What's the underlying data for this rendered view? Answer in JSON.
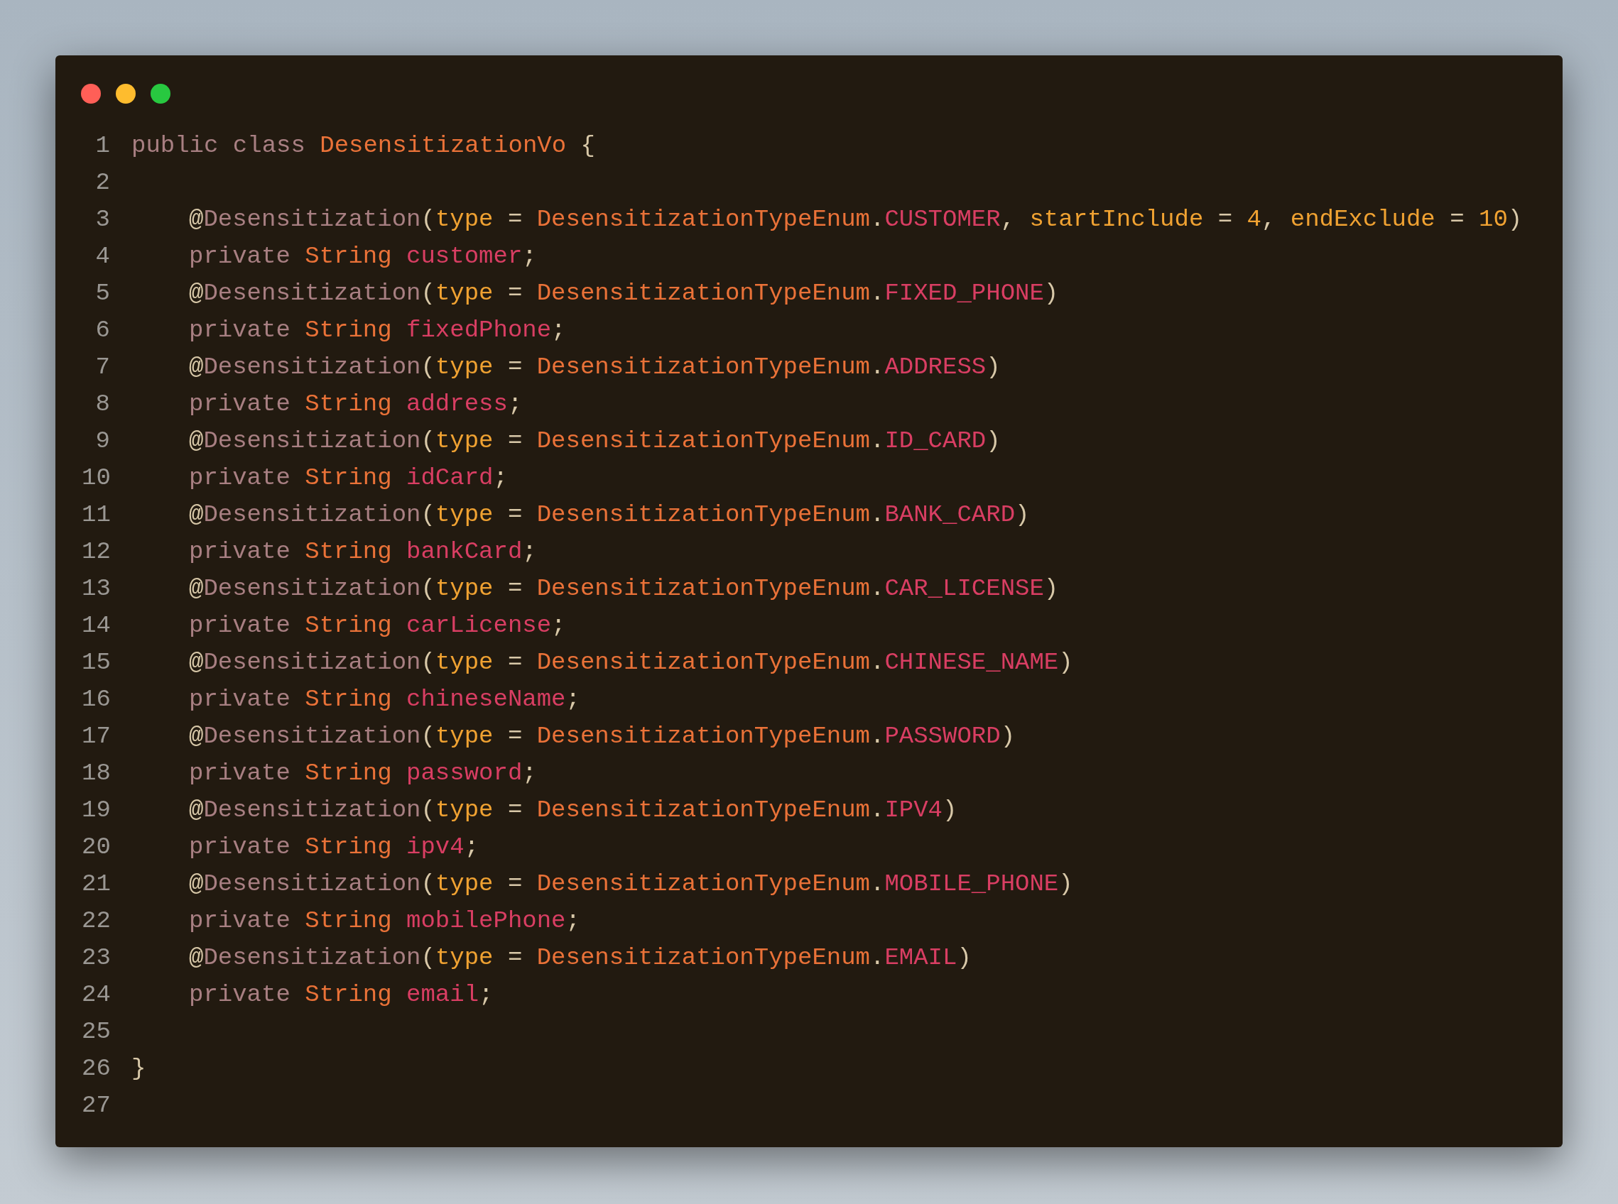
{
  "window": {
    "controls": [
      {
        "kind": "close"
      },
      {
        "kind": "minimize"
      },
      {
        "kind": "maximize"
      }
    ]
  },
  "lines": [
    {
      "number": "1",
      "indented": false,
      "tokens": [
        {
          "kind": "keyword",
          "text": "public class "
        },
        {
          "kind": "type",
          "text": "DesensitizationVo "
        },
        {
          "kind": "punct",
          "text": "{"
        }
      ]
    },
    {
      "number": "2"
    },
    {
      "number": "3",
      "indented": true,
      "tokens": [
        {
          "kind": "punct",
          "text": "@"
        },
        {
          "kind": "keyword",
          "text": "Desensitization"
        },
        {
          "kind": "punct",
          "text": "("
        },
        {
          "kind": "param",
          "text": "type "
        },
        {
          "kind": "punct",
          "text": "= "
        },
        {
          "kind": "type",
          "text": "DesensitizationTypeEnum"
        },
        {
          "kind": "punct",
          "text": "."
        },
        {
          "kind": "field",
          "text": "CUSTOMER"
        },
        {
          "kind": "punct",
          "text": ", "
        },
        {
          "kind": "param",
          "text": "startInclude "
        },
        {
          "kind": "punct",
          "text": "= "
        },
        {
          "kind": "param",
          "text": "4"
        },
        {
          "kind": "punct",
          "text": ", "
        },
        {
          "kind": "param",
          "text": "endExclude "
        },
        {
          "kind": "punct",
          "text": "= "
        },
        {
          "kind": "param",
          "text": "10"
        },
        {
          "kind": "punct",
          "text": ")"
        }
      ]
    },
    {
      "number": "4",
      "indented": true,
      "tokens": [
        {
          "kind": "keyword",
          "text": "private "
        },
        {
          "kind": "type",
          "text": "String "
        },
        {
          "kind": "field",
          "text": "customer"
        },
        {
          "kind": "punct",
          "text": ";"
        }
      ]
    },
    {
      "number": "5",
      "indented": true,
      "tokens": [
        {
          "kind": "punct",
          "text": "@"
        },
        {
          "kind": "keyword",
          "text": "Desensitization"
        },
        {
          "kind": "punct",
          "text": "("
        },
        {
          "kind": "param",
          "text": "type "
        },
        {
          "kind": "punct",
          "text": "= "
        },
        {
          "kind": "type",
          "text": "DesensitizationTypeEnum"
        },
        {
          "kind": "punct",
          "text": "."
        },
        {
          "kind": "field",
          "text": "FIXED_PHONE"
        },
        {
          "kind": "punct",
          "text": ")"
        }
      ]
    },
    {
      "number": "6",
      "indented": true,
      "tokens": [
        {
          "kind": "keyword",
          "text": "private "
        },
        {
          "kind": "type",
          "text": "String "
        },
        {
          "kind": "field",
          "text": "fixedPhone"
        },
        {
          "kind": "punct",
          "text": ";"
        }
      ]
    },
    {
      "number": "7",
      "indented": true,
      "tokens": [
        {
          "kind": "punct",
          "text": "@"
        },
        {
          "kind": "keyword",
          "text": "Desensitization"
        },
        {
          "kind": "punct",
          "text": "("
        },
        {
          "kind": "param",
          "text": "type "
        },
        {
          "kind": "punct",
          "text": "= "
        },
        {
          "kind": "type",
          "text": "DesensitizationTypeEnum"
        },
        {
          "kind": "punct",
          "text": "."
        },
        {
          "kind": "field",
          "text": "ADDRESS"
        },
        {
          "kind": "punct",
          "text": ")"
        }
      ]
    },
    {
      "number": "8",
      "indented": true,
      "tokens": [
        {
          "kind": "keyword",
          "text": "private "
        },
        {
          "kind": "type",
          "text": "String "
        },
        {
          "kind": "field",
          "text": "address"
        },
        {
          "kind": "punct",
          "text": ";"
        }
      ]
    },
    {
      "number": "9",
      "indented": true,
      "tokens": [
        {
          "kind": "punct",
          "text": "@"
        },
        {
          "kind": "keyword",
          "text": "Desensitization"
        },
        {
          "kind": "punct",
          "text": "("
        },
        {
          "kind": "param",
          "text": "type "
        },
        {
          "kind": "punct",
          "text": "= "
        },
        {
          "kind": "type",
          "text": "DesensitizationTypeEnum"
        },
        {
          "kind": "punct",
          "text": "."
        },
        {
          "kind": "field",
          "text": "ID_CARD"
        },
        {
          "kind": "punct",
          "text": ")"
        }
      ]
    },
    {
      "number": "10",
      "indented": true,
      "tokens": [
        {
          "kind": "keyword",
          "text": "private "
        },
        {
          "kind": "type",
          "text": "String "
        },
        {
          "kind": "field",
          "text": "idCard"
        },
        {
          "kind": "punct",
          "text": ";"
        }
      ]
    },
    {
      "number": "11",
      "indented": true,
      "tokens": [
        {
          "kind": "punct",
          "text": "@"
        },
        {
          "kind": "keyword",
          "text": "Desensitization"
        },
        {
          "kind": "punct",
          "text": "("
        },
        {
          "kind": "param",
          "text": "type "
        },
        {
          "kind": "punct",
          "text": "= "
        },
        {
          "kind": "type",
          "text": "DesensitizationTypeEnum"
        },
        {
          "kind": "punct",
          "text": "."
        },
        {
          "kind": "field",
          "text": "BANK_CARD"
        },
        {
          "kind": "punct",
          "text": ")"
        }
      ]
    },
    {
      "number": "12",
      "indented": true,
      "tokens": [
        {
          "kind": "keyword",
          "text": "private "
        },
        {
          "kind": "type",
          "text": "String "
        },
        {
          "kind": "field",
          "text": "bankCard"
        },
        {
          "kind": "punct",
          "text": ";"
        }
      ]
    },
    {
      "number": "13",
      "indented": true,
      "tokens": [
        {
          "kind": "punct",
          "text": "@"
        },
        {
          "kind": "keyword",
          "text": "Desensitization"
        },
        {
          "kind": "punct",
          "text": "("
        },
        {
          "kind": "param",
          "text": "type "
        },
        {
          "kind": "punct",
          "text": "= "
        },
        {
          "kind": "type",
          "text": "DesensitizationTypeEnum"
        },
        {
          "kind": "punct",
          "text": "."
        },
        {
          "kind": "field",
          "text": "CAR_LICENSE"
        },
        {
          "kind": "punct",
          "text": ")"
        }
      ]
    },
    {
      "number": "14",
      "indented": true,
      "tokens": [
        {
          "kind": "keyword",
          "text": "private "
        },
        {
          "kind": "type",
          "text": "String "
        },
        {
          "kind": "field",
          "text": "carLicense"
        },
        {
          "kind": "punct",
          "text": ";"
        }
      ]
    },
    {
      "number": "15",
      "indented": true,
      "tokens": [
        {
          "kind": "punct",
          "text": "@"
        },
        {
          "kind": "keyword",
          "text": "Desensitization"
        },
        {
          "kind": "punct",
          "text": "("
        },
        {
          "kind": "param",
          "text": "type "
        },
        {
          "kind": "punct",
          "text": "= "
        },
        {
          "kind": "type",
          "text": "DesensitizationTypeEnum"
        },
        {
          "kind": "punct",
          "text": "."
        },
        {
          "kind": "field",
          "text": "CHINESE_NAME"
        },
        {
          "kind": "punct",
          "text": ")"
        }
      ]
    },
    {
      "number": "16",
      "indented": true,
      "tokens": [
        {
          "kind": "keyword",
          "text": "private "
        },
        {
          "kind": "type",
          "text": "String "
        },
        {
          "kind": "field",
          "text": "chineseName"
        },
        {
          "kind": "punct",
          "text": ";"
        }
      ]
    },
    {
      "number": "17",
      "indented": true,
      "tokens": [
        {
          "kind": "punct",
          "text": "@"
        },
        {
          "kind": "keyword",
          "text": "Desensitization"
        },
        {
          "kind": "punct",
          "text": "("
        },
        {
          "kind": "param",
          "text": "type "
        },
        {
          "kind": "punct",
          "text": "= "
        },
        {
          "kind": "type",
          "text": "DesensitizationTypeEnum"
        },
        {
          "kind": "punct",
          "text": "."
        },
        {
          "kind": "field",
          "text": "PASSWORD"
        },
        {
          "kind": "punct",
          "text": ")"
        }
      ]
    },
    {
      "number": "18",
      "indented": true,
      "tokens": [
        {
          "kind": "keyword",
          "text": "private "
        },
        {
          "kind": "type",
          "text": "String "
        },
        {
          "kind": "field",
          "text": "password"
        },
        {
          "kind": "punct",
          "text": ";"
        }
      ]
    },
    {
      "number": "19",
      "indented": true,
      "tokens": [
        {
          "kind": "punct",
          "text": "@"
        },
        {
          "kind": "keyword",
          "text": "Desensitization"
        },
        {
          "kind": "punct",
          "text": "("
        },
        {
          "kind": "param",
          "text": "type "
        },
        {
          "kind": "punct",
          "text": "= "
        },
        {
          "kind": "type",
          "text": "DesensitizationTypeEnum"
        },
        {
          "kind": "punct",
          "text": "."
        },
        {
          "kind": "field",
          "text": "IPV4"
        },
        {
          "kind": "punct",
          "text": ")"
        }
      ]
    },
    {
      "number": "20",
      "indented": true,
      "tokens": [
        {
          "kind": "keyword",
          "text": "private "
        },
        {
          "kind": "type",
          "text": "String "
        },
        {
          "kind": "field",
          "text": "ipv4"
        },
        {
          "kind": "punct",
          "text": ";"
        }
      ]
    },
    {
      "number": "21",
      "indented": true,
      "tokens": [
        {
          "kind": "punct",
          "text": "@"
        },
        {
          "kind": "keyword",
          "text": "Desensitization"
        },
        {
          "kind": "punct",
          "text": "("
        },
        {
          "kind": "param",
          "text": "type "
        },
        {
          "kind": "punct",
          "text": "= "
        },
        {
          "kind": "type",
          "text": "DesensitizationTypeEnum"
        },
        {
          "kind": "punct",
          "text": "."
        },
        {
          "kind": "field",
          "text": "MOBILE_PHONE"
        },
        {
          "kind": "punct",
          "text": ")"
        }
      ]
    },
    {
      "number": "22",
      "indented": true,
      "tokens": [
        {
          "kind": "keyword",
          "text": "private "
        },
        {
          "kind": "type",
          "text": "String "
        },
        {
          "kind": "field",
          "text": "mobilePhone"
        },
        {
          "kind": "punct",
          "text": ";"
        }
      ]
    },
    {
      "number": "23",
      "indented": true,
      "tokens": [
        {
          "kind": "punct",
          "text": "@"
        },
        {
          "kind": "keyword",
          "text": "Desensitization"
        },
        {
          "kind": "punct",
          "text": "("
        },
        {
          "kind": "param",
          "text": "type "
        },
        {
          "kind": "punct",
          "text": "= "
        },
        {
          "kind": "type",
          "text": "DesensitizationTypeEnum"
        },
        {
          "kind": "punct",
          "text": "."
        },
        {
          "kind": "field",
          "text": "EMAIL"
        },
        {
          "kind": "punct",
          "text": ")"
        }
      ]
    },
    {
      "number": "24",
      "indented": true,
      "tokens": [
        {
          "kind": "keyword",
          "text": "private "
        },
        {
          "kind": "type",
          "text": "String "
        },
        {
          "kind": "field",
          "text": "email"
        },
        {
          "kind": "punct",
          "text": ";"
        }
      ]
    },
    {
      "number": "25"
    },
    {
      "number": "26",
      "indented": false,
      "tokens": [
        {
          "kind": "punct",
          "text": "}"
        }
      ]
    },
    {
      "number": "27"
    }
  ]
}
